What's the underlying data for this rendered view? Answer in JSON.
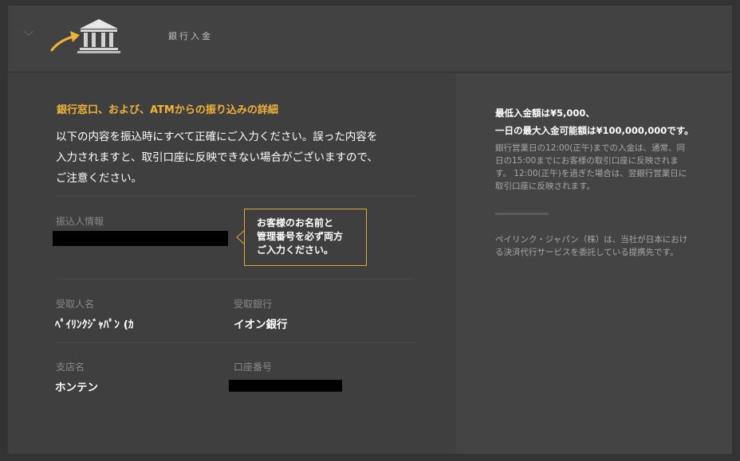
{
  "header": {
    "title": "銀行入金",
    "collapse_icon": "chevron-down-icon",
    "arrow_icon": "arrow-icon",
    "bank_icon": "bank-icon"
  },
  "details": {
    "section_title": "銀行窓口、および、ATMからの振り込みの詳細",
    "intro_lines": [
      "以下の内容を振込時にすべて正確にご入力ください。誤った内容を",
      "入力されますと、取引口座に反映できない場合がございますので、",
      "ご注意ください。"
    ],
    "depositor_label": "振込人情報",
    "tooltip_lines": [
      "お客様のお名前と",
      "管理番号を必ず両方",
      "ご入力ください。"
    ],
    "recipient_label": "受取人名",
    "recipient_value": "ﾍﾟｲﾘﾝｸｼﾞｬﾊﾟﾝ (ｶ",
    "bank_label": "受取銀行",
    "bank_value": "イオン銀行",
    "branch_label": "支店名",
    "branch_value": "ホンテン",
    "account_label": "口座番号"
  },
  "info": {
    "min_deposit": "最低入金額は¥5,000、",
    "max_deposit": "一日の最大入金可能額は¥100,000,000です。",
    "timing_lines": [
      "銀行営業日の12:00(正午)までの入金は、通常、同",
      "日の15:00までにお客様の取引口座に反映されま",
      "す。 12:00(正午)を過ぎた場合は、翌銀行営業日に",
      "取引口座に反映されます。"
    ],
    "provider_lines": [
      "ペイリンク・ジャパン（株）は、当社が日本におけ",
      "る決済代行サービスを委託している提携先です。"
    ]
  },
  "colors": {
    "accent": "#f0b23a",
    "panel": "#3f3f3f",
    "side_panel": "#444444"
  }
}
